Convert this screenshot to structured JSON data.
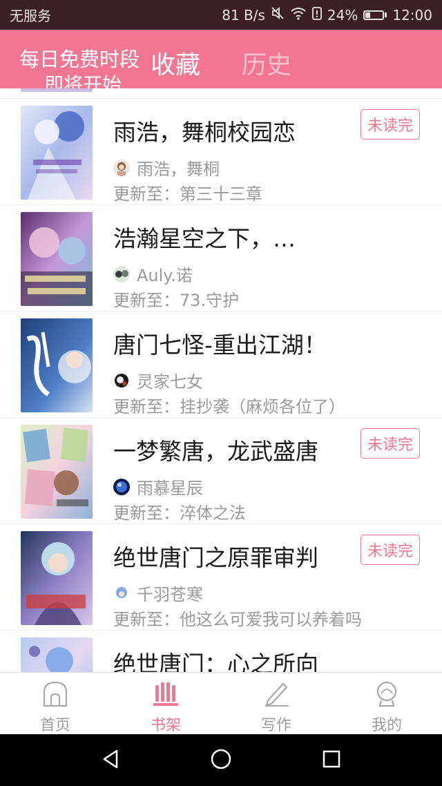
{
  "status_bar": {
    "carrier": "无服务",
    "speed": "81 B/s",
    "battery": "24%",
    "battery_level": 0.24,
    "time": "12:00",
    "icons": [
      "mute-icon",
      "wifi-icon",
      "battery-alert-icon",
      "battery-icon"
    ]
  },
  "header": {
    "promo_line1": "每日免费时段",
    "promo_line2": "即将开始",
    "tabs": [
      {
        "label": "收藏",
        "active": true
      },
      {
        "label": "历史",
        "active": false
      }
    ]
  },
  "books": [
    {
      "title": "雨浩，舞桐校园恋",
      "author": "雨浩，舞桐",
      "update": "更新至：第三十三章",
      "badge": "未读完"
    },
    {
      "title": "浩瀚星空之下，…",
      "author": "Auly.诺",
      "update": "更新至：73.守护",
      "badge": ""
    },
    {
      "title": "唐门七怪-重出江湖！",
      "author": "灵家七女",
      "update": "更新至：挂抄袭（麻烦各位了）",
      "badge": ""
    },
    {
      "title": "一梦繁唐，龙武盛唐",
      "author": "雨慕星辰",
      "update": "更新至：淬体之法",
      "badge": "未读完"
    },
    {
      "title": "绝世唐门之原罪审判",
      "author": "千羽苍寒",
      "update": "更新至：他这么可爱我可以养着吗",
      "badge": "未读完"
    },
    {
      "title": "绝世唐门：心之所向",
      "author": "",
      "update": "",
      "badge": ""
    }
  ],
  "bottom_nav": [
    {
      "label": "首页",
      "icon": "home-icon",
      "active": false
    },
    {
      "label": "书架",
      "icon": "bookshelf-icon",
      "active": true
    },
    {
      "label": "写作",
      "icon": "pencil-icon",
      "active": false
    },
    {
      "label": "我的",
      "icon": "profile-icon",
      "active": false
    }
  ],
  "colors": {
    "accent": "#f27691",
    "status_bar_bg": "#3a1f27",
    "inactive_tab": "#f9c1cd",
    "muted_text": "#9a9a9a"
  }
}
